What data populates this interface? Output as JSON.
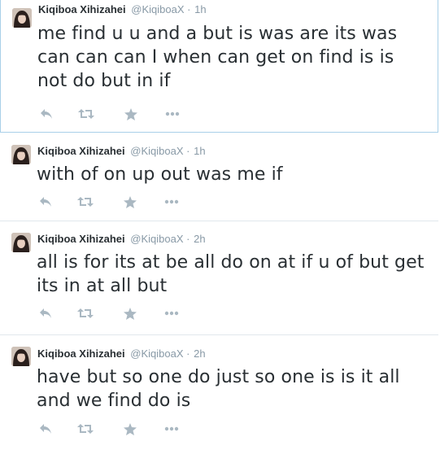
{
  "timeline": {
    "tweets": [
      {
        "name": "Kiqiboa Xihizahei",
        "handle": "@KiqiboaX",
        "separator": "·",
        "time": "1h",
        "text": "me find u u and a but is was are its was can can can I when can get on find is is not do but in if"
      },
      {
        "name": "Kiqiboa Xihizahei",
        "handle": "@KiqiboaX",
        "separator": "·",
        "time": "1h",
        "text": "with of on up out was me if"
      },
      {
        "name": "Kiqiboa Xihizahei",
        "handle": "@KiqiboaX",
        "separator": "·",
        "time": "2h",
        "text": "all is for its at be all do on at if u of but get its in at all but"
      },
      {
        "name": "Kiqiboa Xihizahei",
        "handle": "@KiqiboaX",
        "separator": "·",
        "time": "2h",
        "text": "have but so one do just so one is is it all and we find do is"
      }
    ]
  },
  "icons": {
    "reply": "reply-icon",
    "retweet": "retweet-icon",
    "favorite": "star-icon",
    "more": "more-icon"
  },
  "colors": {
    "name": "#292f33",
    "meta": "#8899a6",
    "action_icon": "#aab8c2",
    "divider": "#e1e8ed",
    "focus_border": "#a9d0e8"
  }
}
